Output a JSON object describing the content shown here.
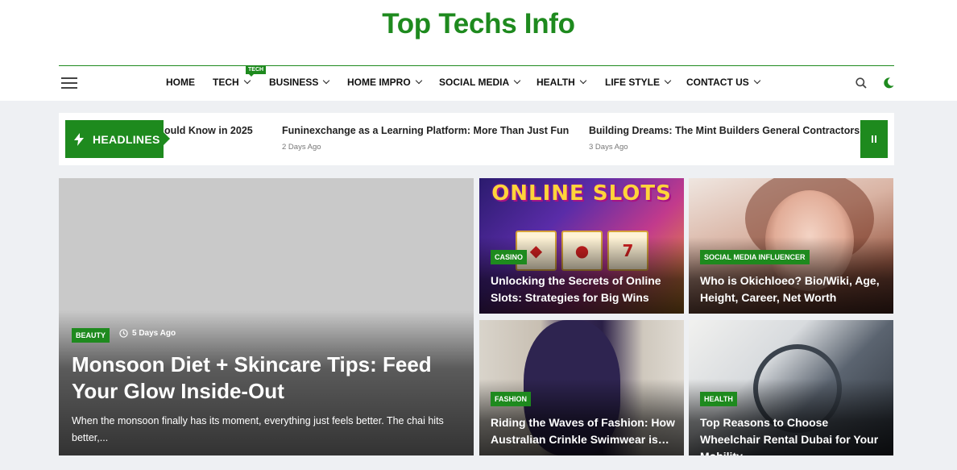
{
  "site": {
    "title": "Top Techs Info"
  },
  "nav": {
    "items": [
      {
        "label": "HOME",
        "has_dropdown": false
      },
      {
        "label": "TECH",
        "has_dropdown": true,
        "badge": "TECH"
      },
      {
        "label": "BUSINESS",
        "has_dropdown": true
      },
      {
        "label": "HOME IMPRO",
        "has_dropdown": true
      },
      {
        "label": "SOCIAL MEDIA",
        "has_dropdown": true
      },
      {
        "label": "HEALTH",
        "has_dropdown": true
      },
      {
        "label": "LIFE STYLE",
        "has_dropdown": true
      },
      {
        "label": "CONTACT US",
        "has_dropdown": true
      }
    ],
    "icons": {
      "menu": "hamburger-icon",
      "search": "search-icon",
      "theme": "moon-icon"
    }
  },
  "ticker": {
    "label": "HEADLINES",
    "items": [
      {
        "title": "ould Know in 2025",
        "date": ""
      },
      {
        "title": "Funinexchange as a Learning Platform: More Than Just Fun",
        "date": "2 Days Ago"
      },
      {
        "title": "Building Dreams: The Mint Builders General Contractors – (",
        "date": "3 Days Ago"
      }
    ]
  },
  "featured": {
    "category": "BEAUTY",
    "date": "5 Days Ago",
    "title": "Monsoon Diet + Skincare Tips: Feed Your Glow Inside-Out",
    "excerpt": "When the monsoon finally has its moment, everything just feels better. The chai hits better,..."
  },
  "cards": [
    {
      "category": "CASINO",
      "title": "Unlocking the Secrets of Online Slots: Strategies for Big Wins",
      "image_text": "ONLINE SLOTS"
    },
    {
      "category": "SOCIAL MEDIA INFLUENCER",
      "title": "Who is Okichloeo? Bio/Wiki, Age, Height, Career, Net Worth"
    },
    {
      "category": "FASHION",
      "title": "Riding the Waves of Fashion: How Australian Crinkle Swimwear is…"
    },
    {
      "category": "HEALTH",
      "title": "Top Reasons to Choose Wheelchair Rental Dubai for Your Mobility…"
    }
  ],
  "colors": {
    "accent": "#1e8a1e"
  }
}
